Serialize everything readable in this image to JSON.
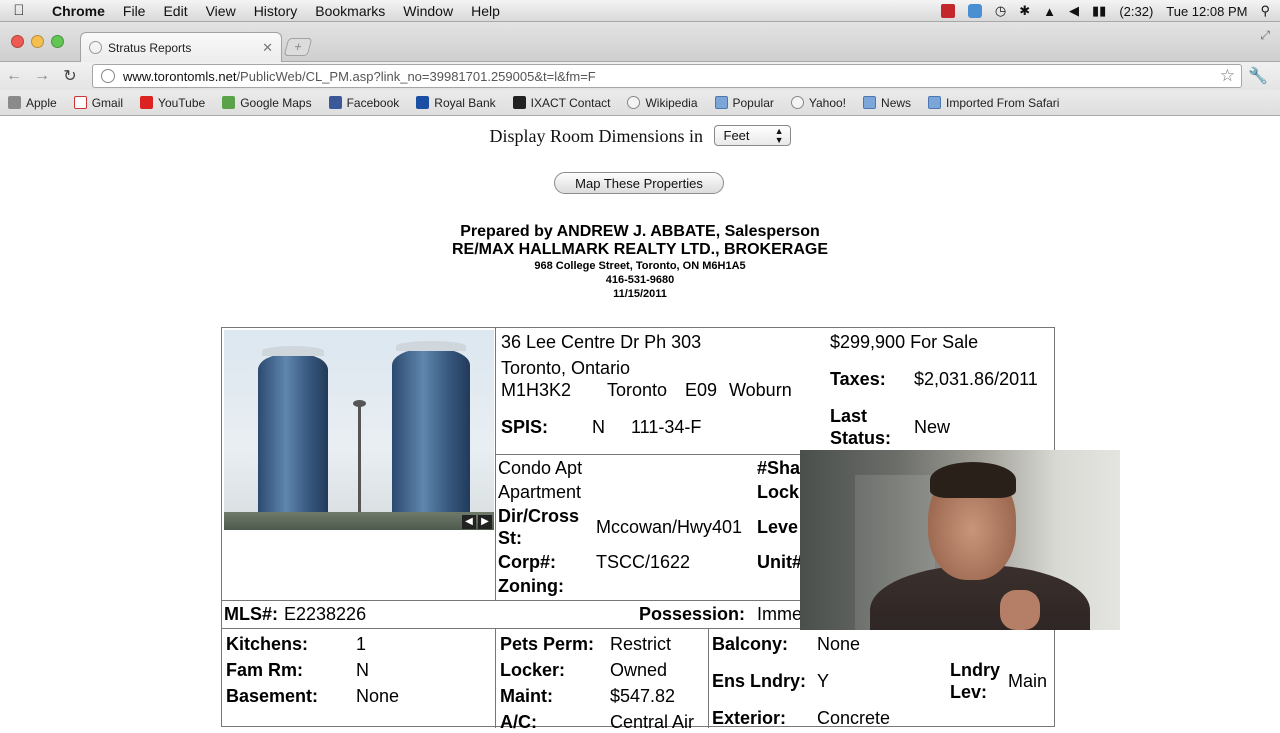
{
  "menubar": {
    "app": "Chrome",
    "items": [
      "File",
      "Edit",
      "View",
      "History",
      "Bookmarks",
      "Window",
      "Help"
    ],
    "battery": "(2:32)",
    "clock": "Tue 12:08 PM"
  },
  "tab": {
    "title": "Stratus Reports"
  },
  "address": {
    "host": "www.torontomls.net",
    "path": "/PublicWeb/CL_PM.asp?link_no=39981701.259005&t=l&fm=F"
  },
  "bookmarks": [
    "Apple",
    "Gmail",
    "YouTube",
    "Google Maps",
    "Facebook",
    "Royal Bank",
    "IXACT Contact",
    "Wikipedia",
    "Popular",
    "Yahoo!",
    "News",
    "Imported From Safari"
  ],
  "page": {
    "dim_label": "Display Room Dimensions in",
    "dim_value": "Feet",
    "map_button": "Map These Properties",
    "prepared": {
      "line1": "Prepared by ANDREW J. ABBATE, Salesperson",
      "line2": "RE/MAX HALLMARK REALTY LTD., BROKERAGE",
      "address": "968 College Street, Toronto, ON M6H1A5",
      "phone": "416-531-9680",
      "date": "11/15/2011"
    }
  },
  "listing": {
    "address1": "36 Lee Centre Dr Ph 303",
    "address2": "Toronto, Ontario",
    "postal": "M1H3K2",
    "city": "Toronto",
    "district": "E09",
    "area": "Woburn",
    "spis_label": "SPIS:",
    "spis_value": "N",
    "map_ref": "111-34-F",
    "price": "$299,900 For Sale",
    "taxes_label": "Taxes:",
    "taxes_value": "$2,031.86/2011",
    "last_status_label_1": "Last",
    "last_status_label_2": "Status:",
    "last_status_value": "New",
    "type1": "Condo Apt",
    "type2": "Apartment",
    "dircross_label_1": "Dir/Cross",
    "dircross_label_2": "St:",
    "dircross_value": "Mccowan/Hwy401",
    "corp_label": "Corp#:",
    "corp_value": "TSCC/1622",
    "zoning_label": "Zoning:",
    "right_col": [
      "#Sha",
      "Lock",
      "Leve",
      "Unit#"
    ],
    "mls_label": "MLS#:",
    "mls_value": "E2238226",
    "possession_label": "Possession:",
    "possession_value": "Imme",
    "kitchens_label": "Kitchens:",
    "kitchens_value": "1",
    "famrm_label": "Fam Rm:",
    "famrm_value": "N",
    "basement_label": "Basement:",
    "basement_value": "None",
    "pets_label": "Pets Perm:",
    "pets_value": "Restrict",
    "locker_label": "Locker:",
    "locker_value": "Owned",
    "maint_label": "Maint:",
    "maint_value": "$547.82",
    "ac_label": "A/C:",
    "ac_value": "Central Air",
    "balcony_label": "Balcony:",
    "balcony_value": "None",
    "ensl_label": "Ens Lndry:",
    "ensl_value": "Y",
    "lndry_label_1": "Lndry",
    "lndry_label_2": "Lev:",
    "lndry_value": "Main",
    "exterior_label": "Exterior:",
    "exterior_value": "Concrete"
  }
}
